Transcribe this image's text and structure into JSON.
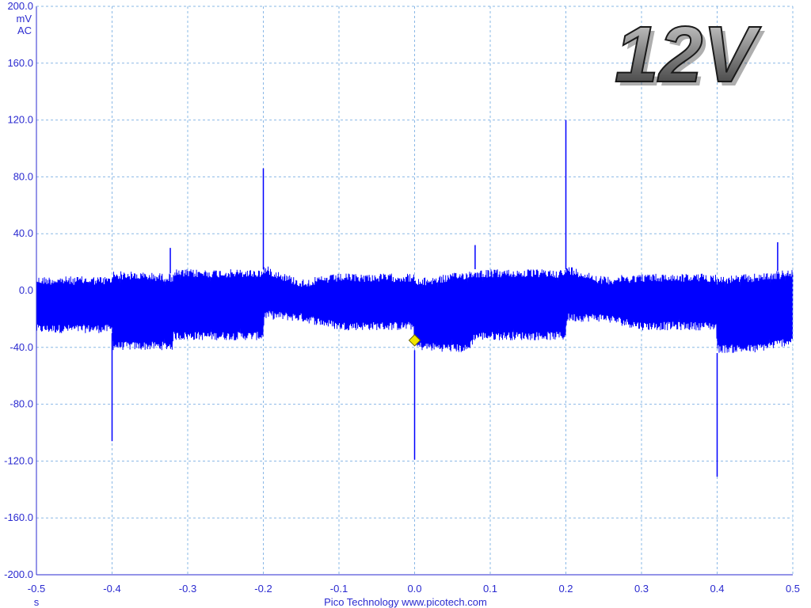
{
  "chart_data": {
    "type": "line",
    "title": "",
    "xlabel": "",
    "ylabel": "",
    "x_unit": "s",
    "y_unit_lines": [
      "mV",
      "AC"
    ],
    "xlim": [
      -0.5,
      0.5
    ],
    "ylim": [
      -200,
      200
    ],
    "x_ticks": [
      "-0.5",
      "-0.4",
      "-0.3",
      "-0.2",
      "-0.1",
      "0.0",
      "0.1",
      "0.2",
      "0.3",
      "0.4",
      "0.5"
    ],
    "y_ticks": [
      "200.0",
      "160.0",
      "120.0",
      "80.0",
      "40.0",
      "0.0",
      "-40.0",
      "-80.0",
      "-120.0",
      "-160.0",
      "-200.0"
    ],
    "grid": true,
    "footer": "Pico Technology  www.picotech.com",
    "badge": "12V",
    "trigger_marker": {
      "x": 0.0,
      "y": -35
    },
    "series": [
      {
        "color": "#0000ff",
        "envelope": {
          "x": [
            -0.5,
            -0.4,
            -0.399,
            -0.32,
            -0.319,
            -0.2,
            -0.199,
            -0.15,
            -0.1,
            -0.05,
            -0.001,
            0.0,
            0.07,
            0.08,
            0.2,
            0.201,
            0.25,
            0.3,
            0.35,
            0.399,
            0.4,
            0.45,
            0.5
          ],
          "upper": [
            10,
            10,
            14,
            12,
            15,
            15,
            18,
            8,
            12,
            12,
            12,
            8,
            14,
            15,
            15,
            18,
            10,
            12,
            12,
            12,
            10,
            12,
            15
          ],
          "lower": [
            -30,
            -30,
            -42,
            -42,
            -35,
            -35,
            -20,
            -22,
            -28,
            -28,
            -28,
            -42,
            -44,
            -35,
            -35,
            -22,
            -22,
            -28,
            -28,
            -28,
            -44,
            -44,
            -38
          ]
        },
        "spikes": [
          {
            "x": -0.4,
            "peak": -106
          },
          {
            "x": -0.323,
            "peak": 30
          },
          {
            "x": -0.2,
            "peak": 86
          },
          {
            "x": 0.0,
            "peak": -119
          },
          {
            "x": 0.08,
            "peak": 32
          },
          {
            "x": 0.2,
            "peak": 120
          },
          {
            "x": 0.4,
            "peak": -131
          },
          {
            "x": 0.48,
            "peak": 34
          }
        ]
      }
    ]
  },
  "colors": {
    "trace": "#0000ff",
    "grid": "#8ab8e6",
    "axis": "#2a2ad0",
    "marker": "#f2e600"
  }
}
